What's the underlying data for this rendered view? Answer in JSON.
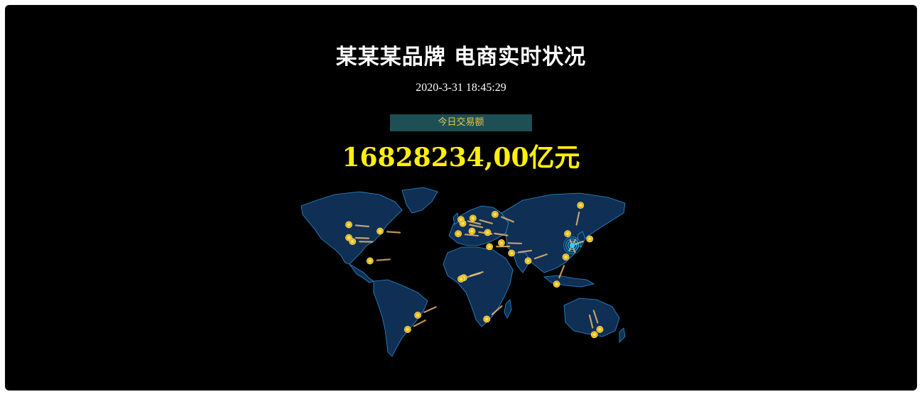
{
  "header": {
    "title": "某某某品牌 电商实时状况",
    "datetime": "2020-3-31 18:45:29"
  },
  "summary": {
    "label": "今日交易额",
    "amount": "16828234,00",
    "unit": "亿元"
  },
  "colors": {
    "background": "#000000",
    "accent_yellow": "#ffef0a",
    "label_bg": "#1d4f55",
    "label_text": "#e6c84a",
    "land": "#0f2f55",
    "border": "#2a8fd0",
    "marker": "#f5c518",
    "target_ring": "#2fd3ff"
  },
  "map": {
    "points": [
      {
        "name": "seattle",
        "lon": -122,
        "lat": 47
      },
      {
        "name": "sf",
        "lon": -122,
        "lat": 37
      },
      {
        "name": "la",
        "lon": -118,
        "lat": 34
      },
      {
        "name": "chicago",
        "lon": -88,
        "lat": 42
      },
      {
        "name": "mexico-city",
        "lon": -99,
        "lat": 19
      },
      {
        "name": "sao-paulo",
        "lon": -47,
        "lat": -23
      },
      {
        "name": "buenos-aires",
        "lon": -58,
        "lat": -34
      },
      {
        "name": "london",
        "lon": 0,
        "lat": 51
      },
      {
        "name": "paris",
        "lon": 2,
        "lat": 48
      },
      {
        "name": "berlin",
        "lon": 13,
        "lat": 52
      },
      {
        "name": "rome",
        "lon": 12,
        "lat": 42
      },
      {
        "name": "madrid",
        "lon": -3,
        "lat": 40
      },
      {
        "name": "moscow",
        "lon": 37,
        "lat": 55
      },
      {
        "name": "cairo",
        "lon": 31,
        "lat": 30
      },
      {
        "name": "istanbul",
        "lon": 29,
        "lat": 41
      },
      {
        "name": "dubai",
        "lon": 55,
        "lat": 25
      },
      {
        "name": "mumbai",
        "lon": 73,
        "lat": 19
      },
      {
        "name": "lagos",
        "lon": 3,
        "lat": 6
      },
      {
        "name": "accra",
        "lon": 0,
        "lat": 5
      },
      {
        "name": "johannesburg",
        "lon": 28,
        "lat": -26
      },
      {
        "name": "beijing",
        "lon": 116,
        "lat": 40
      },
      {
        "name": "hong-kong",
        "lon": 114,
        "lat": 22
      },
      {
        "name": "tokyo",
        "lon": 140,
        "lat": 36
      },
      {
        "name": "sydney",
        "lon": 151,
        "lat": -34
      },
      {
        "name": "melbourne",
        "lon": 145,
        "lat": -38
      },
      {
        "name": "yakutsk",
        "lon": 130,
        "lat": 62
      },
      {
        "name": "baghdad",
        "lon": 44,
        "lat": 33
      },
      {
        "name": "singapore",
        "lon": 104,
        "lat": 1
      }
    ],
    "target": {
      "name": "shanghai",
      "lon": 121,
      "lat": 31
    }
  }
}
